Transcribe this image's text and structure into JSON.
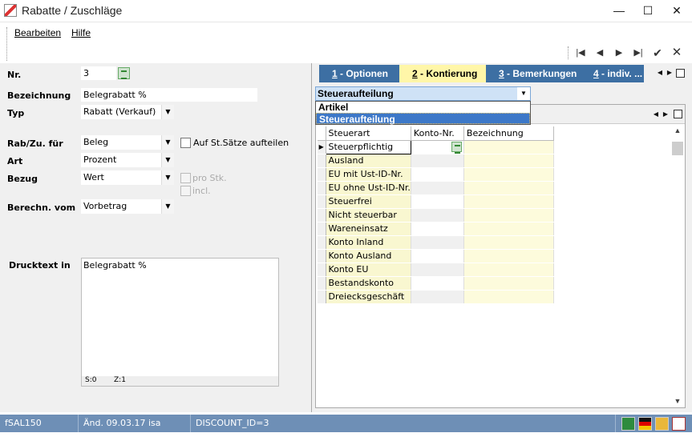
{
  "window": {
    "title": "Rabatte / Zuschläge",
    "minimize_icon": "minimize-icon",
    "maximize_icon": "maximize-icon",
    "close_icon": "close-icon"
  },
  "menu": {
    "items": [
      "Bearbeiten",
      "Hilfe"
    ]
  },
  "nav": {
    "first": "|◀",
    "prev": "◀",
    "next": "▶",
    "last": "▶|",
    "ok": "✔",
    "cancel": "✕"
  },
  "form": {
    "nr_label": "Nr.",
    "nr_value": "3",
    "bezeichnung_label": "Bezeichnung",
    "bezeichnung_value": "Belegrabatt %",
    "typ_label": "Typ",
    "typ_value": "Rabatt (Verkauf)",
    "rabzu_label": "Rab/Zu. für",
    "rabzu_value": "Beleg",
    "auf_st_label": "Auf St.Sätze aufteilen",
    "art_label": "Art",
    "art_value": "Prozent",
    "bezug_label": "Bezug",
    "bezug_value": "Wert",
    "pro_stk_label": "pro Stk.",
    "incl_label": "incl.",
    "berechn_label": "Berechn. vom",
    "berechn_value": "Vorbetrag",
    "drucktext_label": "Drucktext in",
    "drucktext_value": "Belegrabatt %",
    "status_s": "S:0",
    "status_z": "Z:1"
  },
  "tabs": [
    {
      "num": "1",
      "label": " - Optionen"
    },
    {
      "num": "2",
      "label": " - Kontierung"
    },
    {
      "num": "3",
      "label": " - Bemerkungen"
    },
    {
      "num": "4",
      "label": " - indiv. ..."
    }
  ],
  "dropdown": {
    "selected": "Steueraufteilung",
    "options": [
      "Artikel",
      "Steueraufteilung"
    ]
  },
  "grid": {
    "columns": [
      "Steuerart",
      "Konto-Nr.",
      "Bezeichnung"
    ],
    "rows": [
      "Steuerpflichtig",
      "Ausland",
      "EU mit Ust-ID-Nr.",
      "EU ohne Ust-ID-Nr.",
      "Steuerfrei",
      "Nicht steuerbar",
      "Wareneinsatz",
      "Konto Inland",
      "Konto Ausland",
      "Konto EU",
      "Bestandskonto",
      "Dreiecksgeschäft"
    ]
  },
  "status": {
    "form_id": "fSAL150",
    "changed": "Änd. 09.03.17 isa",
    "record": "DISCOUNT_ID=3"
  }
}
